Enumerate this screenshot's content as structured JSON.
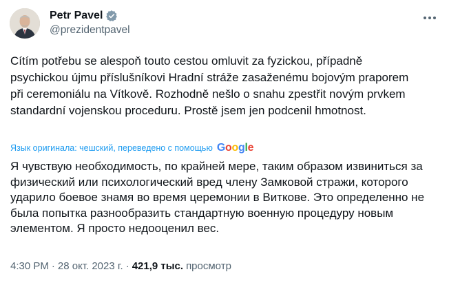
{
  "author": {
    "display_name": "Petr Pavel",
    "handle": "@prezidentpavel",
    "verified": true,
    "avatar_icon": "profile-photo"
  },
  "tweet": {
    "text": "Cítím potřebu se alespoň touto cestou omluvit za fyzickou, případně psychickou újmu příslušníkovi Hradní stráže zasaženému bojovým praporem při ceremoniálu na Vítkově. Rozhodně nešlo o snahu zpestřit novým prvkem standardní vojenskou proceduru. Prostě jsem jen podcenil hmotnost."
  },
  "translation": {
    "label": "Язык оригинала: чешский, переведено с помощью",
    "provider": "Google",
    "text": "Я чувствую необходимость, по крайней мере, таким образом извиниться за физический или психологический вред члену Замковой стражи, которого ударило боевое знамя во время церемонии в Виткове. Это определенно не была попытка разнообразить стандартную военную процедуру новым элементом. Я просто недооценил вес."
  },
  "meta": {
    "time": "4:30 PM",
    "separator": "·",
    "date": "28 окт. 2023 г.",
    "views_count": "421,9 тыс.",
    "views_label": "просмотр"
  },
  "colors": {
    "text": "#0f1419",
    "secondary": "#536471",
    "link": "#1d9bf0",
    "verified_badge": "#829aab"
  }
}
